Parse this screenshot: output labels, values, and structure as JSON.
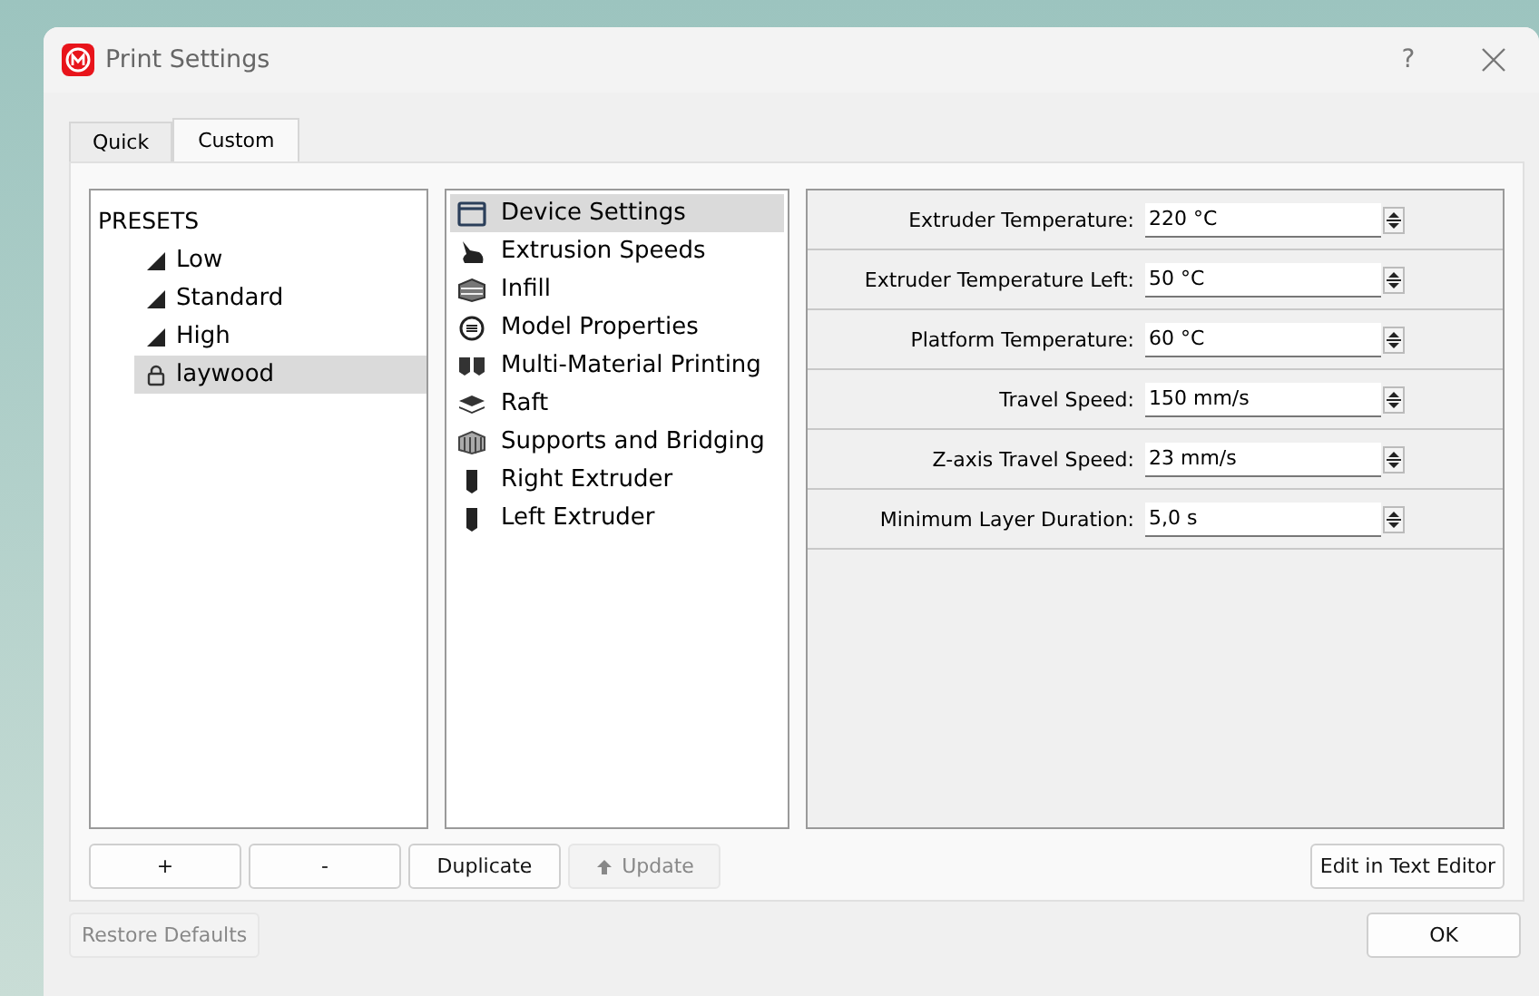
{
  "window": {
    "title": "Print Settings",
    "help": "?"
  },
  "tabs": [
    {
      "label": "Quick",
      "selected": false
    },
    {
      "label": "Custom",
      "selected": true
    }
  ],
  "presets": {
    "heading": "PRESETS",
    "items": [
      {
        "label": "Low",
        "kind": "quality",
        "selected": false
      },
      {
        "label": "Standard",
        "kind": "quality",
        "selected": false
      },
      {
        "label": "High",
        "kind": "quality",
        "selected": false
      },
      {
        "label": "laywood",
        "kind": "locked",
        "selected": true
      }
    ]
  },
  "categories": [
    {
      "label": "Device Settings",
      "kind": "device",
      "selected": true
    },
    {
      "label": "Extrusion Speeds",
      "kind": "speed",
      "selected": false
    },
    {
      "label": "Infill",
      "kind": "infill",
      "selected": false
    },
    {
      "label": "Model Properties",
      "kind": "model",
      "selected": false
    },
    {
      "label": "Multi-Material Printing",
      "kind": "multi",
      "selected": false
    },
    {
      "label": "Raft",
      "kind": "raft",
      "selected": false
    },
    {
      "label": "Supports and Bridging",
      "kind": "support",
      "selected": false
    },
    {
      "label": "Right Extruder",
      "kind": "extruder",
      "selected": false
    },
    {
      "label": "Left Extruder",
      "kind": "extruder",
      "selected": false
    }
  ],
  "settings": [
    {
      "label": "Extruder Temperature:",
      "value": "220 °C"
    },
    {
      "label": "Extruder Temperature Left:",
      "value": "50 °C"
    },
    {
      "label": "Platform Temperature:",
      "value": "60 °C"
    },
    {
      "label": "Travel Speed:",
      "value": "150 mm/s"
    },
    {
      "label": "Z-axis Travel Speed:",
      "value": "23 mm/s"
    },
    {
      "label": "Minimum Layer Duration:",
      "value": "5,0 s"
    }
  ],
  "preset_buttons": [
    {
      "label": "+",
      "kind": "plain",
      "disabled": false
    },
    {
      "label": "-",
      "kind": "plain",
      "disabled": false
    },
    {
      "label": "Duplicate",
      "kind": "plain",
      "disabled": false
    },
    {
      "label": "Update",
      "kind": "upload",
      "disabled": true
    }
  ],
  "edit_button": {
    "label": "Edit in Text Editor"
  },
  "restore_button": {
    "label": "Restore Defaults",
    "disabled": true
  },
  "ok_button": {
    "label": "OK"
  }
}
